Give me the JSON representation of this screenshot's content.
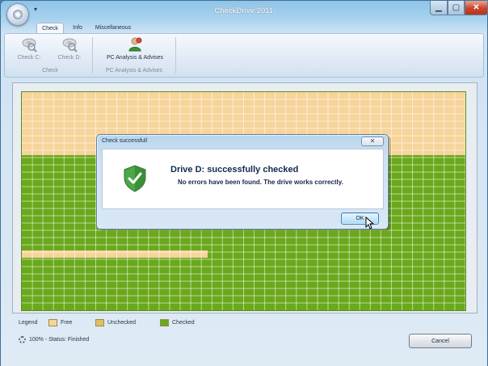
{
  "window": {
    "title": "CheckDrive 2011"
  },
  "ribbon": {
    "tabs": [
      {
        "label": "Check",
        "active": true
      },
      {
        "label": "Info",
        "active": false
      },
      {
        "label": "Miscellaneous",
        "active": false
      }
    ],
    "groups": {
      "check": {
        "label": "Check",
        "buttons": [
          {
            "label": "Check C:",
            "icon": "drive-check-icon",
            "enabled": false
          },
          {
            "label": "Check D:",
            "icon": "drive-check-icon",
            "enabled": false
          }
        ]
      },
      "pc": {
        "label": "PC Analysis & Advises",
        "buttons": [
          {
            "label": "PC Analysis & Advises",
            "icon": "user-analysis-icon",
            "enabled": true
          }
        ]
      }
    }
  },
  "drive_map": {
    "colors": {
      "free": "#f6d49a",
      "unchecked": "#e0c060",
      "checked": "#6aa81c"
    }
  },
  "legend": {
    "title": "Legend",
    "items": [
      {
        "label": "Free",
        "color": "#f6d49a"
      },
      {
        "label": "Unchecked",
        "color": "#e0c060"
      },
      {
        "label": "Checked",
        "color": "#6aa81c"
      }
    ]
  },
  "status": {
    "text": "100% - Status: Finished"
  },
  "buttons": {
    "cancel": "Cancel"
  },
  "dialog": {
    "title": "Check successfull",
    "close_glyph": "✕",
    "heading": "Drive D: successfully checked",
    "message": "No errors have been found. The drive works correctly.",
    "ok": "OK",
    "icon": "shield-check-icon"
  }
}
